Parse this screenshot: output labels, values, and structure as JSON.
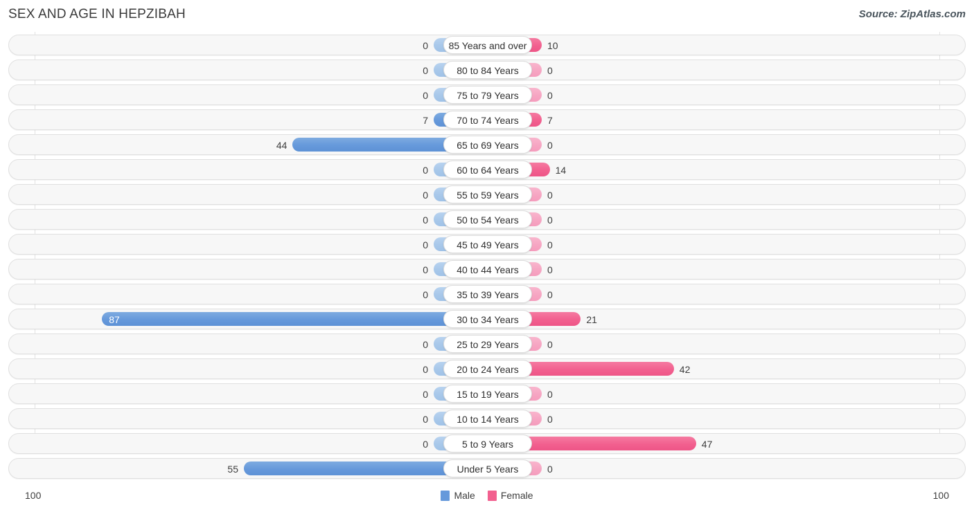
{
  "header": {
    "title": "SEX AND AGE IN HEPZIBAH",
    "source": "Source: ZipAtlas.com"
  },
  "legend": {
    "male_label": "Male",
    "female_label": "Female",
    "male_color": "#6699DB",
    "female_color": "#F2608F"
  },
  "axis": {
    "left_max_label": "100",
    "right_max_label": "100"
  },
  "chart_data": {
    "type": "bar",
    "subtype": "population-pyramid",
    "title": "SEX AND AGE IN HEPZIBAH",
    "xlabel": "",
    "ylabel": "",
    "xlim": [
      0,
      100
    ],
    "grid": true,
    "legend_position": "bottom-center",
    "categories": [
      "85 Years and over",
      "80 to 84 Years",
      "75 to 79 Years",
      "70 to 74 Years",
      "65 to 69 Years",
      "60 to 64 Years",
      "55 to 59 Years",
      "50 to 54 Years",
      "45 to 49 Years",
      "40 to 44 Years",
      "35 to 39 Years",
      "30 to 34 Years",
      "25 to 29 Years",
      "20 to 24 Years",
      "15 to 19 Years",
      "10 to 14 Years",
      "5 to 9 Years",
      "Under 5 Years"
    ],
    "series": [
      {
        "name": "Male",
        "color": "#6699DB",
        "direction": "left",
        "values": [
          0,
          0,
          0,
          7,
          44,
          0,
          0,
          0,
          0,
          0,
          0,
          87,
          0,
          0,
          0,
          0,
          0,
          55
        ]
      },
      {
        "name": "Female",
        "color": "#F2608F",
        "direction": "right",
        "values": [
          10,
          0,
          0,
          7,
          0,
          14,
          0,
          0,
          0,
          0,
          0,
          21,
          0,
          42,
          0,
          0,
          47,
          0
        ]
      }
    ]
  }
}
